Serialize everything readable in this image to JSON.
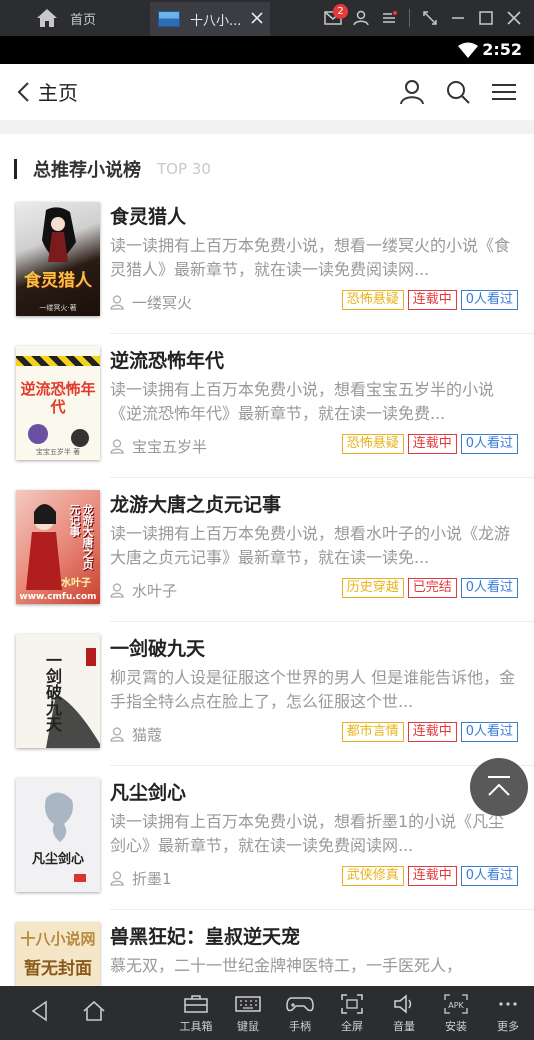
{
  "emulator": {
    "home_label": "首页",
    "tab_label": "十八小...",
    "message_badge": "2"
  },
  "status": {
    "time": "2:52"
  },
  "header": {
    "title": "主页"
  },
  "section": {
    "title": "总推荐小说榜",
    "subtitle": "TOP 30"
  },
  "books": [
    {
      "title": "食灵猎人",
      "desc": "读一读拥有上百万本免费小说，想看一缕冥火的小说《食灵猎人》最新章节，就在读一读免费阅读网...",
      "author": "一缕冥火",
      "tags": [
        "恐怖悬疑",
        "连载中",
        "0人看过"
      ],
      "cover_text": "食灵猎人",
      "cover_small": "一缕冥火·著"
    },
    {
      "title": "逆流恐怖年代",
      "desc": "读一读拥有上百万本免费小说，想看宝宝五岁半的小说《逆流恐怖年代》最新章节，就在读一读免费...",
      "author": "宝宝五岁半",
      "tags": [
        "恐怖悬疑",
        "连载中",
        "0人看过"
      ],
      "cover_text": "逆流恐怖年代",
      "cover_small": "宝宝五岁半 著"
    },
    {
      "title": "龙游大唐之贞元记事",
      "desc": "读一读拥有上百万本免费小说，想看水叶子的小说《龙游大唐之贞元记事》最新章节，就在读一读免...",
      "author": "水叶子",
      "tags": [
        "历史穿越",
        "已完结",
        "0人看过"
      ],
      "cover_text": "龙游大唐之贞元记事",
      "cover_small": "水叶子",
      "cover_url": "www.cmfu.com"
    },
    {
      "title": "一剑破九天",
      "desc": "柳灵霄的人设是征服这个世界的男人 但是谁能告诉他，金手指全特么点在脸上了，怎么征服这个世...",
      "author": "猫蔻",
      "tags": [
        "都市言情",
        "连载中",
        "0人看过"
      ],
      "cover_text": "一剑破九天"
    },
    {
      "title": "凡尘剑心",
      "desc": "读一读拥有上百万本免费小说，想看折墨1的小说《凡尘剑心》最新章节，就在读一读免费阅读网...",
      "author": "折墨1",
      "tags": [
        "武侠修真",
        "连载中",
        "0人看过"
      ],
      "cover_text": "凡尘剑心"
    },
    {
      "title": "兽黑狂妃：皇叔逆天宠",
      "desc": "慕无双，二十一世纪金牌神医特工，一手医死人，",
      "author": "",
      "tags": [],
      "cover_text": "十八小说网",
      "cover_small": "暂无封面"
    }
  ],
  "bottom_toolbar": [
    "工具箱",
    "键鼠",
    "手柄",
    "全屏",
    "音量",
    "安装",
    "更多"
  ],
  "colors": {
    "tag_genre": "#e8b21a",
    "tag_status": "#e4393c",
    "tag_views": "#3a7bd5"
  }
}
